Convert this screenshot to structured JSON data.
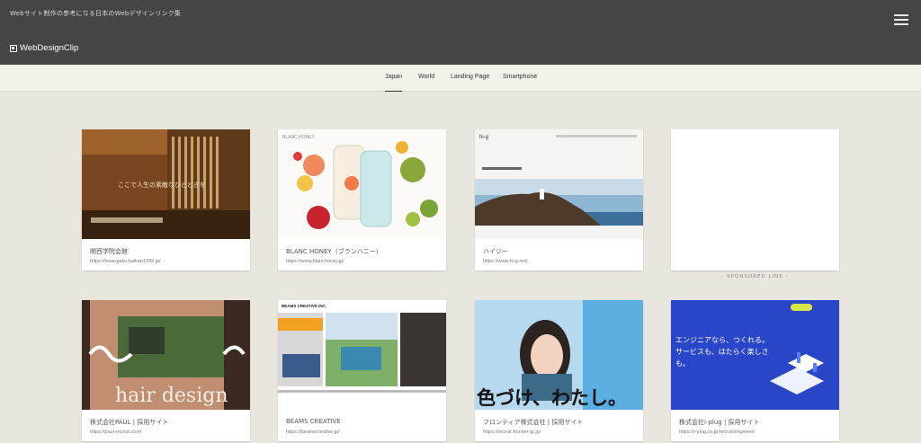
{
  "header": {
    "tagline": "Webサイト制作の参考になる日本のWebデザインリンク集",
    "logo_text": "WebDesignClip",
    "menu_icon": "hamburger-menu-icon",
    "bg_color": "#454545"
  },
  "tabs": [
    {
      "label": "Japan",
      "active": true
    },
    {
      "label": "World",
      "active": false
    },
    {
      "label": "Landing Page",
      "active": false
    },
    {
      "label": "Smartphone",
      "active": false
    }
  ],
  "cards": [
    {
      "title": "関西学院会館",
      "url": "https://kwangaku-kaikan1999.jp/",
      "thumb_text": "ここで人生の素敵なひとときを"
    },
    {
      "title": "BLANC HONEY（ブランハニー）",
      "url": "https://www.blanchoney.jp/",
      "thumb_text": "BLANC HONEY"
    },
    {
      "title": "ハイジー",
      "url": "https://www.hi-g.net/",
      "thumb_text": "hi-g"
    },
    {
      "title": "",
      "url": "",
      "thumb_text": ""
    },
    {
      "title": "株式会社PAUL | 採用サイト",
      "url": "https://paul-recruit.com/",
      "thumb_text": "hair design"
    },
    {
      "title": "BEAMS CREATIVE",
      "url": "https://beamscreative.jp/",
      "thumb_text": "BEAMS CREATIVE INC."
    },
    {
      "title": "フロンティア株式会社 | 採用サイト",
      "url": "https://recruit.frontier-gr.jp/",
      "thumb_text": "色づけ、わたし。"
    },
    {
      "title": "株式会社i-plug | 採用サイト",
      "url": "https://i-plug.co.jp/recruit/engineer/",
      "thumb_text": "エンジニアなら、つくれる。サービスも、はたらく楽しさも。"
    }
  ],
  "sponsored_label": "- SPONSORED LINK -"
}
